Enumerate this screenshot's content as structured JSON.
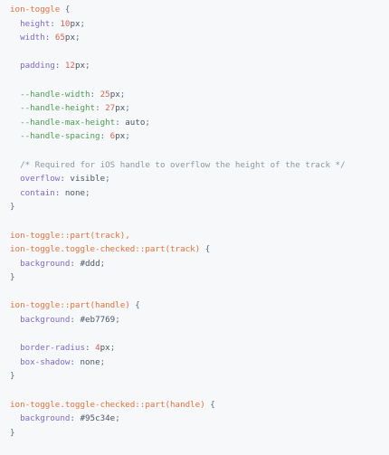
{
  "code": {
    "lines": [
      [
        [
          "sel",
          "ion-toggle"
        ],
        [
          "punc",
          " {"
        ]
      ],
      [
        [
          "punc",
          "  "
        ],
        [
          "prop",
          "height"
        ],
        [
          "punc",
          ": "
        ],
        [
          "num",
          "10"
        ],
        [
          "val",
          "px"
        ],
        [
          "punc",
          ";"
        ]
      ],
      [
        [
          "punc",
          "  "
        ],
        [
          "prop",
          "width"
        ],
        [
          "punc",
          ": "
        ],
        [
          "num",
          "65"
        ],
        [
          "val",
          "px"
        ],
        [
          "punc",
          ";"
        ]
      ],
      [],
      [
        [
          "punc",
          "  "
        ],
        [
          "prop",
          "padding"
        ],
        [
          "punc",
          ": "
        ],
        [
          "num",
          "12"
        ],
        [
          "val",
          "px"
        ],
        [
          "punc",
          ";"
        ]
      ],
      [],
      [
        [
          "punc",
          "  "
        ],
        [
          "var",
          "--handle-width"
        ],
        [
          "punc",
          ": "
        ],
        [
          "num",
          "25"
        ],
        [
          "val",
          "px"
        ],
        [
          "punc",
          ";"
        ]
      ],
      [
        [
          "punc",
          "  "
        ],
        [
          "var",
          "--handle-height"
        ],
        [
          "punc",
          ": "
        ],
        [
          "num",
          "27"
        ],
        [
          "val",
          "px"
        ],
        [
          "punc",
          ";"
        ]
      ],
      [
        [
          "punc",
          "  "
        ],
        [
          "var",
          "--handle-max-height"
        ],
        [
          "punc",
          ": "
        ],
        [
          "val",
          "auto"
        ],
        [
          "punc",
          ";"
        ]
      ],
      [
        [
          "punc",
          "  "
        ],
        [
          "var",
          "--handle-spacing"
        ],
        [
          "punc",
          ": "
        ],
        [
          "num",
          "6"
        ],
        [
          "val",
          "px"
        ],
        [
          "punc",
          ";"
        ]
      ],
      [],
      [
        [
          "punc",
          "  "
        ],
        [
          "cmt",
          "/* Required for iOS handle to overflow the height of the track */"
        ]
      ],
      [
        [
          "punc",
          "  "
        ],
        [
          "prop",
          "overflow"
        ],
        [
          "punc",
          ": "
        ],
        [
          "val",
          "visible"
        ],
        [
          "punc",
          ";"
        ]
      ],
      [
        [
          "punc",
          "  "
        ],
        [
          "prop",
          "contain"
        ],
        [
          "punc",
          ": "
        ],
        [
          "val",
          "none"
        ],
        [
          "punc",
          ";"
        ]
      ],
      [
        [
          "punc",
          "}"
        ]
      ],
      [],
      [
        [
          "sel",
          "ion-toggle::part(track),"
        ]
      ],
      [
        [
          "sel",
          "ion-toggle.toggle-checked::part(track)"
        ],
        [
          "punc",
          " {"
        ]
      ],
      [
        [
          "punc",
          "  "
        ],
        [
          "prop",
          "background"
        ],
        [
          "punc",
          ": "
        ],
        [
          "val",
          "#ddd"
        ],
        [
          "punc",
          ";"
        ]
      ],
      [
        [
          "punc",
          "}"
        ]
      ],
      [],
      [
        [
          "sel",
          "ion-toggle::part(handle)"
        ],
        [
          "punc",
          " {"
        ]
      ],
      [
        [
          "punc",
          "  "
        ],
        [
          "prop",
          "background"
        ],
        [
          "punc",
          ": "
        ],
        [
          "val",
          "#eb7769"
        ],
        [
          "punc",
          ";"
        ]
      ],
      [],
      [
        [
          "punc",
          "  "
        ],
        [
          "prop",
          "border-radius"
        ],
        [
          "punc",
          ": "
        ],
        [
          "num",
          "4"
        ],
        [
          "val",
          "px"
        ],
        [
          "punc",
          ";"
        ]
      ],
      [
        [
          "punc",
          "  "
        ],
        [
          "prop",
          "box-shadow"
        ],
        [
          "punc",
          ": "
        ],
        [
          "val",
          "none"
        ],
        [
          "punc",
          ";"
        ]
      ],
      [
        [
          "punc",
          "}"
        ]
      ],
      [],
      [
        [
          "sel",
          "ion-toggle.toggle-checked::part(handle)"
        ],
        [
          "punc",
          " {"
        ]
      ],
      [
        [
          "punc",
          "  "
        ],
        [
          "prop",
          "background"
        ],
        [
          "punc",
          ": "
        ],
        [
          "val",
          "#95c34e"
        ],
        [
          "punc",
          ";"
        ]
      ],
      [
        [
          "punc",
          "}"
        ]
      ]
    ]
  }
}
